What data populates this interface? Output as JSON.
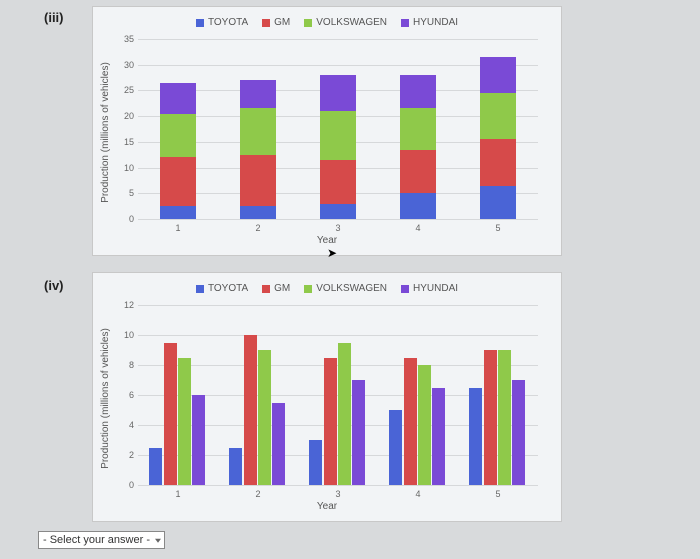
{
  "labels": {
    "iii": "(iii)",
    "iv": "(iv)"
  },
  "colors": {
    "TOYOTA": "#4a64d6",
    "GM": "#d64a4a",
    "VOLKSWAGEN": "#8fc94a",
    "HYUNDAI": "#7a4ad6"
  },
  "legend": [
    "TOYOTA",
    "GM",
    "VOLKSWAGEN",
    "HYUNDAI"
  ],
  "select_placeholder": "- Select your answer -",
  "chart_data": [
    {
      "id": "iii",
      "type": "bar",
      "stacked": true,
      "title": "",
      "xlabel": "Year",
      "ylabel": "Production (millions of vehicles)",
      "categories": [
        "1",
        "2",
        "3",
        "4",
        "5"
      ],
      "ylim": [
        0,
        35
      ],
      "yticks": [
        0,
        5,
        10,
        15,
        20,
        25,
        30,
        35
      ],
      "series": [
        {
          "name": "TOYOTA",
          "values": [
            2.5,
            2.5,
            3,
            5,
            6.5
          ]
        },
        {
          "name": "GM",
          "values": [
            9.5,
            10,
            8.5,
            8.5,
            9
          ]
        },
        {
          "name": "VOLKSWAGEN",
          "values": [
            8.5,
            9,
            9.5,
            8,
            9
          ]
        },
        {
          "name": "HYUNDAI",
          "values": [
            6,
            5.5,
            7,
            6.5,
            7
          ]
        }
      ]
    },
    {
      "id": "iv",
      "type": "bar",
      "stacked": false,
      "title": "",
      "xlabel": "Year",
      "ylabel": "Production (millions of vehicles)",
      "categories": [
        "1",
        "2",
        "3",
        "4",
        "5"
      ],
      "ylim": [
        0,
        12
      ],
      "yticks": [
        0,
        2,
        4,
        6,
        8,
        10,
        12
      ],
      "series": [
        {
          "name": "TOYOTA",
          "values": [
            2.5,
            2.5,
            3,
            5,
            6.5
          ]
        },
        {
          "name": "GM",
          "values": [
            9.5,
            10,
            8.5,
            8.5,
            9
          ]
        },
        {
          "name": "VOLKSWAGEN",
          "values": [
            8.5,
            9,
            9.5,
            8,
            9
          ]
        },
        {
          "name": "HYUNDAI",
          "values": [
            6,
            5.5,
            7,
            6.5,
            7
          ]
        }
      ]
    }
  ]
}
